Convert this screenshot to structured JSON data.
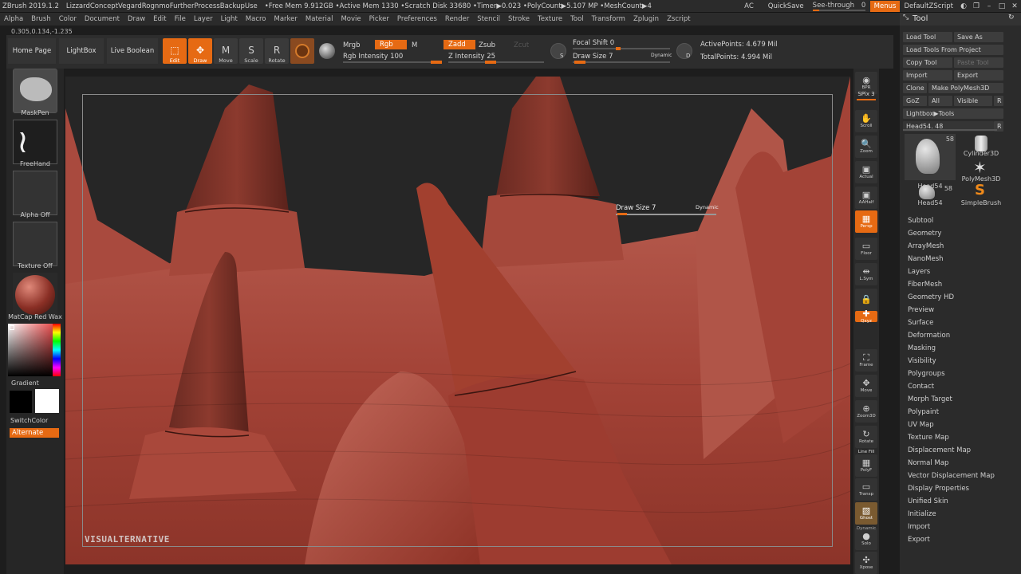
{
  "titlebar": {
    "app": "ZBrush 2019.1.2",
    "file": "LizzardConceptVegardRognmoFurtherProcessBackupUse",
    "stats": "•Free Mem 9.912GB •Active Mem 1330 •Scratch Disk 33680 •Timer▶0.023 •PolyCount▶5.107 MP •MeshCount▶4",
    "ac": "AC",
    "quicksave": "QuickSave",
    "see_through_label": "See-through",
    "see_through_value": "0",
    "menus": "Menus",
    "default_zscript": "DefaultZScript"
  },
  "menubar": [
    "Alpha",
    "Brush",
    "Color",
    "Document",
    "Draw",
    "Edit",
    "File",
    "Layer",
    "Light",
    "Macro",
    "Marker",
    "Material",
    "Movie",
    "Picker",
    "Preferences",
    "Render",
    "Stencil",
    "Stroke",
    "Texture",
    "Tool",
    "Transform",
    "Zplugin",
    "Zscript"
  ],
  "coords": "0.305,0.134,-1.235",
  "shelf": {
    "home_page": "Home Page",
    "lightbox": "LightBox",
    "live_boolean": "Live Boolean",
    "edit": "Edit",
    "draw": "Draw",
    "move": "Move",
    "scale": "Scale",
    "rotate": "Rotate",
    "mrgb": "Mrgb",
    "rgb": "Rgb",
    "m": "M",
    "zadd": "Zadd",
    "zsub": "Zsub",
    "zcut": "Zcut",
    "rgb_intensity_label": "Rgb Intensity",
    "rgb_intensity_value": "100",
    "z_intensity_label": "Z Intensity",
    "z_intensity_value": "25",
    "focal_shift_label": "Focal Shift",
    "focal_shift_value": "0",
    "draw_size_label": "Draw Size",
    "draw_size_value": "7",
    "dynamic": "Dynamic",
    "s_label": "S",
    "d_label": "D",
    "active_points": "ActivePoints: 4.679 Mil",
    "total_points": "TotalPoints: 4.994 Mil"
  },
  "leftpanel": {
    "brush_mask": "MaskPen",
    "stroke": "FreeHand",
    "alpha": "Alpha Off",
    "texture": "Texture Off",
    "material": "MatCap Red Wax",
    "gradient": "Gradient",
    "switch_color": "SwitchColor",
    "alternate": "Alternate"
  },
  "viewport": {
    "watermark": "VISUALTERNATIVE",
    "overlay_draw_size": "Draw Size 7",
    "overlay_dynamic": "Dynamic"
  },
  "rightstrip": [
    {
      "name": "bpr",
      "label": "BPR"
    },
    {
      "name": "spix",
      "label": "SPix 3"
    },
    {
      "name": "scroll",
      "label": "Scroll"
    },
    {
      "name": "zoom",
      "label": "Zoom"
    },
    {
      "name": "actual",
      "label": "Actual"
    },
    {
      "name": "aahalf",
      "label": "AAHalf"
    },
    {
      "name": "persp",
      "label": "Persp"
    },
    {
      "name": "floor",
      "label": "Floor"
    },
    {
      "name": "lsym",
      "label": "L.Sym"
    },
    {
      "name": "lock",
      "label": ""
    },
    {
      "name": "xyz",
      "label": "Qxyz"
    },
    {
      "name": "frame",
      "label": "Frame"
    },
    {
      "name": "move",
      "label": "Move"
    },
    {
      "name": "zoom3d",
      "label": "Zoom3D"
    },
    {
      "name": "rotate",
      "label": "Rotate"
    },
    {
      "name": "polyf",
      "label": "PolyF"
    },
    {
      "name": "transp",
      "label": "Transp"
    },
    {
      "name": "ghost",
      "label": "Ghost"
    },
    {
      "name": "solo",
      "label": "Solo"
    },
    {
      "name": "xpose",
      "label": "Xpose"
    }
  ],
  "rightstrip_extra": {
    "line_fill": "Line Fill",
    "dynamic": "Dynamic"
  },
  "tool": {
    "title": "Tool",
    "load_tool": "Load Tool",
    "save_as": "Save As",
    "load_from_project": "Load Tools From Project",
    "copy_tool": "Copy Tool",
    "paste_tool": "Paste Tool",
    "import": "Import",
    "export": "Export",
    "clone": "Clone",
    "make_polymesh": "Make PolyMesh3D",
    "goz": "GoZ",
    "all": "All",
    "visible": "Visible",
    "r": "R",
    "lightbox_tools": "Lightbox▶Tools",
    "head_slider": "Head54. 48",
    "thumbs": [
      {
        "label": "Head54",
        "count": "58"
      },
      {
        "label": "Cylinder3D",
        "count": ""
      },
      {
        "label": "PolyMesh3D",
        "count": ""
      },
      {
        "label": "Head54",
        "count": "58"
      },
      {
        "label": "SimpleBrush",
        "count": ""
      }
    ],
    "subpalettes": [
      "Subtool",
      "Geometry",
      "ArrayMesh",
      "NanoMesh",
      "Layers",
      "FiberMesh",
      "Geometry HD",
      "Preview",
      "Surface",
      "Deformation",
      "Masking",
      "Visibility",
      "Polygroups",
      "Contact",
      "Morph Target",
      "Polypaint",
      "UV Map",
      "Texture Map",
      "Displacement Map",
      "Normal Map",
      "Vector Displacement Map",
      "Display Properties",
      "Unified Skin",
      "Initialize",
      "Import",
      "Export"
    ]
  },
  "colors": {
    "accent": "#e66a13",
    "clay": "#a8463a",
    "bg": "#242424"
  }
}
